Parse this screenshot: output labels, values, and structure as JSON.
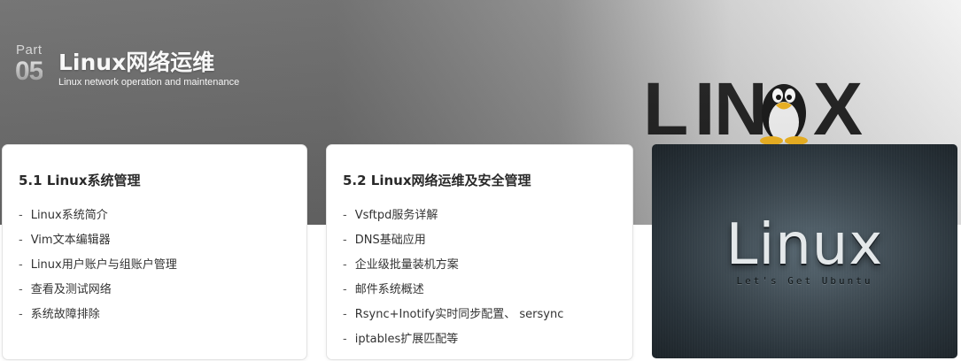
{
  "header": {
    "part_label": "Part",
    "part_number": "05",
    "title": "Linux网络运维",
    "subtitle": "Linux network operation and maintenance"
  },
  "banner_logo": {
    "letters": [
      "L",
      "I",
      "N",
      "X"
    ],
    "mascot": "tux-penguin-icon"
  },
  "cards": [
    {
      "title": "5.1 Linux系统管理",
      "items": [
        "Linux系统简介",
        "Vim文本编辑器",
        "Linux用户账户与组账户管理",
        "查看及测试网络",
        "系统故障排除"
      ]
    },
    {
      "title": "5.2 Linux网络运维及安全管理",
      "items": [
        "Vsftpd服务详解",
        "DNS基础应用",
        "企业级批量装机方案",
        "邮件系统概述",
        "Rsync+Inotify实时同步配置、 sersync",
        "iptables扩展匹配等"
      ]
    }
  ],
  "image_panel": {
    "title": "Linux",
    "subtitle": "Let's Get Ubuntu"
  },
  "list_marker": "-"
}
